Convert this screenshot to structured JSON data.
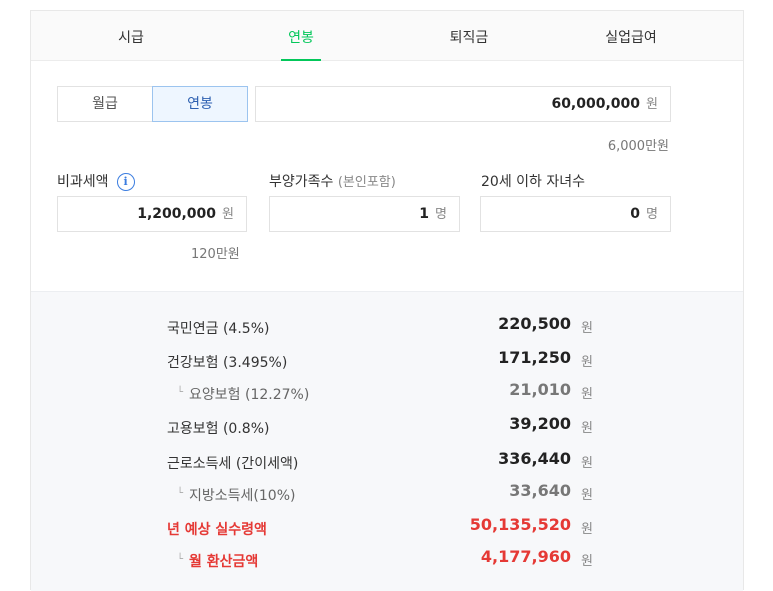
{
  "tabs": [
    {
      "label": "시급"
    },
    {
      "label": "연봉"
    },
    {
      "label": "퇴직금"
    },
    {
      "label": "실업급여"
    }
  ],
  "active_tab": 1,
  "period_toggle": {
    "monthly": "월급",
    "annual": "연봉",
    "selected": "annual"
  },
  "salary": {
    "value": "60,000,000",
    "unit": "원",
    "note": "6,000만원"
  },
  "nontax": {
    "label": "비과세액",
    "info_icon": "info-icon",
    "value": "1,200,000",
    "unit": "원",
    "note": "120만원"
  },
  "dependents": {
    "label": "부양가족수",
    "label_paren": "(본인포함)",
    "value": "1",
    "unit": "명"
  },
  "children": {
    "label": "20세 이하 자녀수",
    "value": "0",
    "unit": "명"
  },
  "results": [
    {
      "label": "국민연금 (4.5%)",
      "amount": "220,500",
      "unit": "원",
      "kind": "main"
    },
    {
      "label": "건강보험 (3.495%)",
      "amount": "171,250",
      "unit": "원",
      "kind": "main"
    },
    {
      "label": "요양보험 (12.27%)",
      "amount": "21,010",
      "unit": "원",
      "kind": "sub"
    },
    {
      "label": "고용보험 (0.8%)",
      "amount": "39,200",
      "unit": "원",
      "kind": "main"
    },
    {
      "label": "근로소득세 (간이세액)",
      "amount": "336,440",
      "unit": "원",
      "kind": "main"
    },
    {
      "label": "지방소득세(10%)",
      "amount": "33,640",
      "unit": "원",
      "kind": "sub"
    },
    {
      "label": "년 예상 실수령액",
      "amount": "50,135,520",
      "unit": "원",
      "kind": "red"
    },
    {
      "label": "월 환산금액",
      "amount": "4,177,960",
      "unit": "원",
      "kind": "red-sub"
    }
  ],
  "colors": {
    "accent_green": "#03c75a",
    "selected_blue": "#2c5fb0",
    "highlight_red": "#e53935"
  }
}
